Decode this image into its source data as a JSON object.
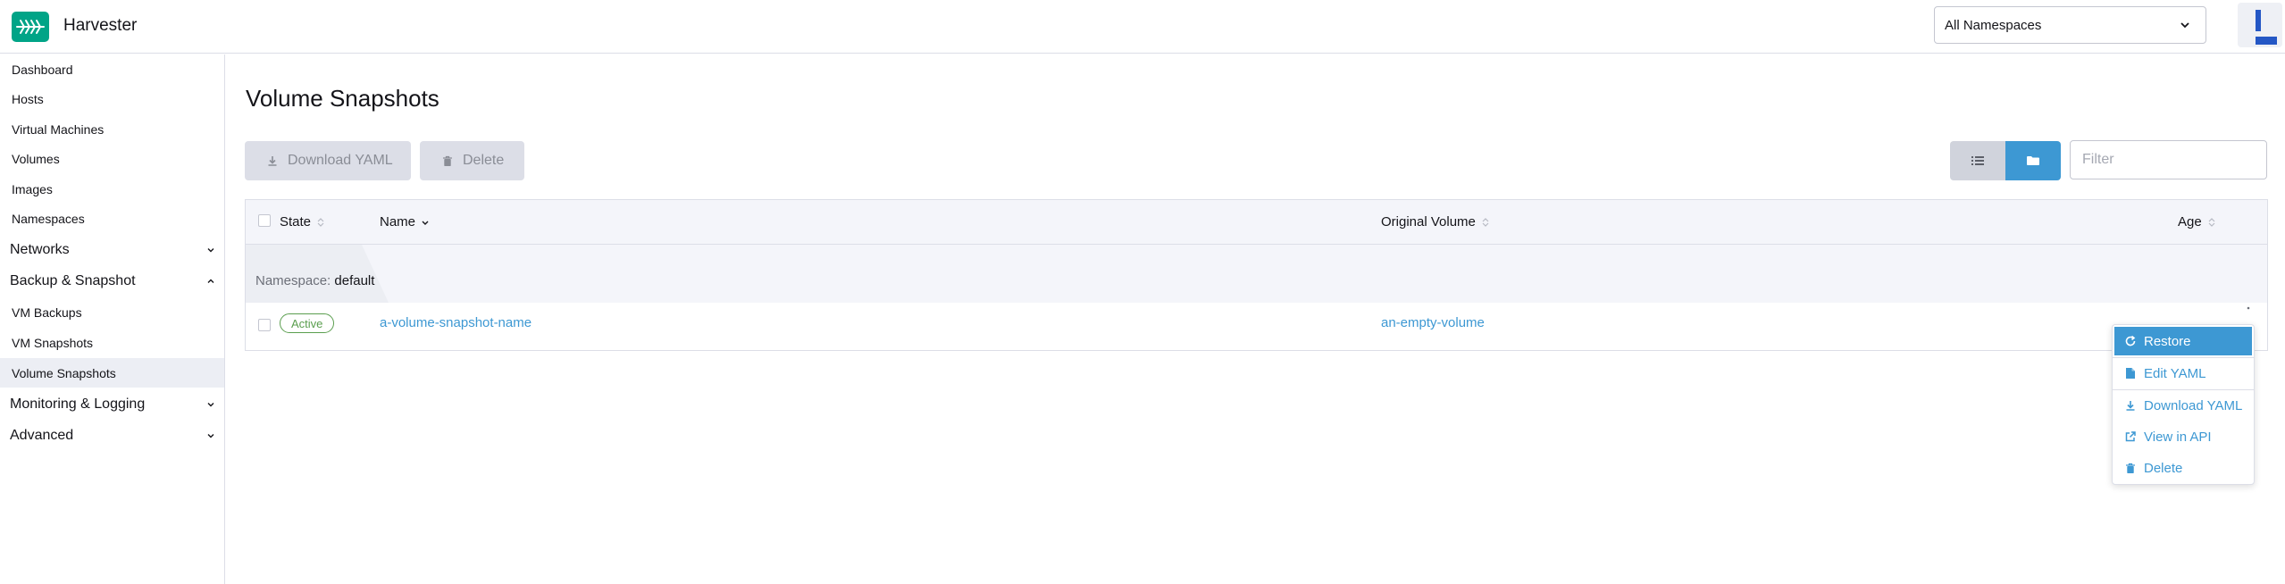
{
  "header": {
    "app_title": "Harvester",
    "namespace_selector": "All Namespaces"
  },
  "sidebar": {
    "items": [
      {
        "label": "Dashboard"
      },
      {
        "label": "Hosts"
      },
      {
        "label": "Virtual Machines"
      },
      {
        "label": "Volumes"
      },
      {
        "label": "Images"
      },
      {
        "label": "Namespaces"
      }
    ],
    "groups": [
      {
        "label": "Networks",
        "expanded": false
      },
      {
        "label": "Backup & Snapshot",
        "expanded": true,
        "children": [
          {
            "label": "VM Backups"
          },
          {
            "label": "VM Snapshots"
          },
          {
            "label": "Volume Snapshots",
            "active": true
          }
        ]
      },
      {
        "label": "Monitoring & Logging",
        "expanded": false
      },
      {
        "label": "Advanced",
        "expanded": false
      }
    ]
  },
  "main": {
    "title": "Volume Snapshots",
    "actions": {
      "download_yaml": "Download YAML",
      "delete": "Delete"
    },
    "filter_placeholder": "Filter",
    "table": {
      "columns": [
        "State",
        "Name",
        "Original Volume",
        "Age"
      ],
      "group": {
        "key": "Namespace:",
        "value": "default"
      },
      "rows": [
        {
          "state": "Active",
          "name": "a-volume-snapshot-name",
          "original_volume": "an-empty-volume"
        }
      ]
    }
  },
  "context_menu": {
    "items": [
      {
        "label": "Restore",
        "icon": "restore-icon",
        "selected": true
      },
      {
        "label": "Edit YAML",
        "icon": "file-icon"
      },
      {
        "label": "Download YAML",
        "icon": "download-icon"
      },
      {
        "label": "View in API",
        "icon": "external-link-icon"
      },
      {
        "label": "Delete",
        "icon": "trash-icon"
      }
    ]
  },
  "colors": {
    "brand": "#00a487",
    "link": "#3d98d3",
    "active_badge": "#5a9e4e",
    "user_avatar": "#2457c5"
  }
}
